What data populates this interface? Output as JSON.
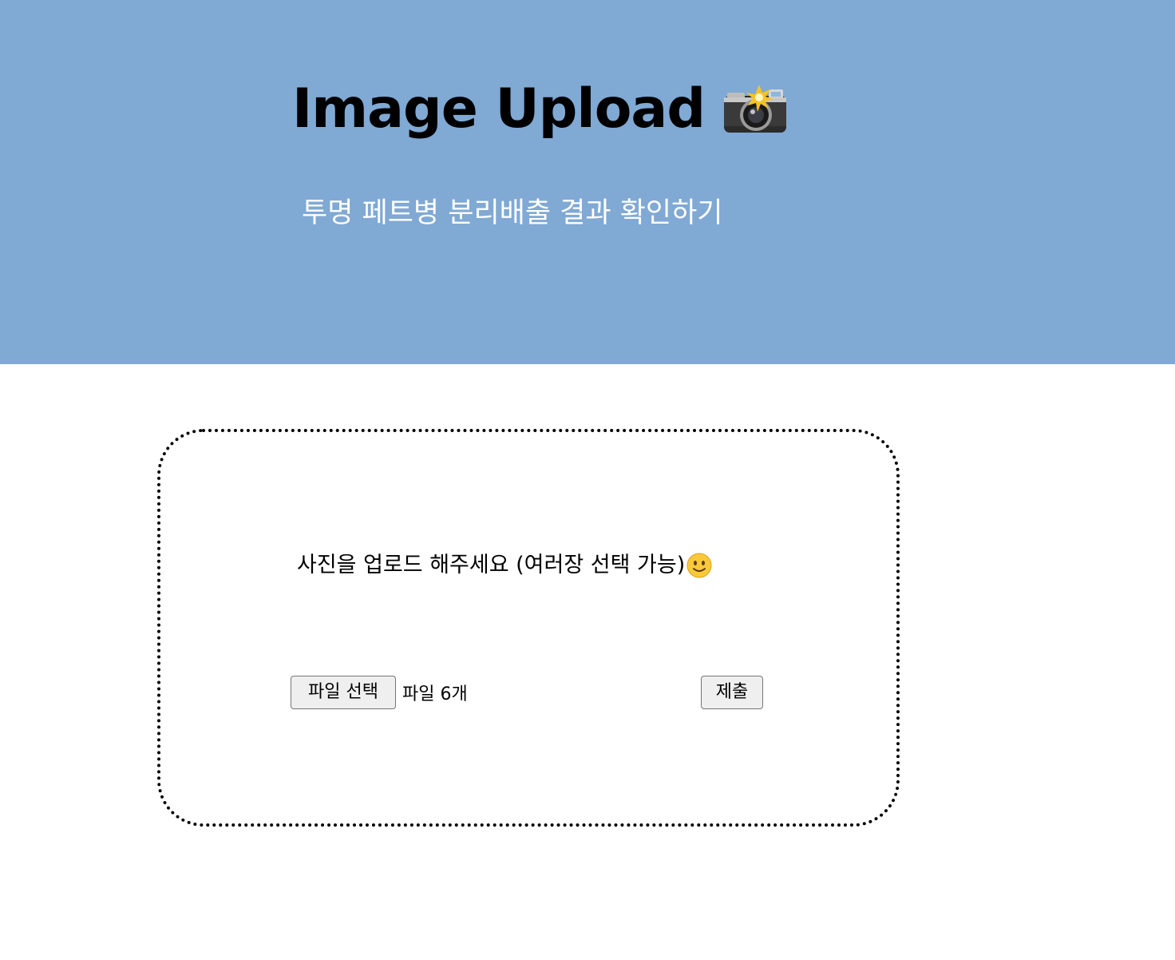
{
  "header": {
    "title": "Image Upload",
    "title_icon": "camera-with-flash-icon",
    "subtitle": "투명 페트병 분리배출 결과 확인하기",
    "background_color": "#80a9d4"
  },
  "upload": {
    "prompt": "사진을 업로드 해주세요 (여러장 선택 가능)",
    "prompt_icon": "slightly-smiling-face-icon",
    "file_button_label": "파일 선택",
    "file_status": "파일 6개",
    "submit_label": "제출"
  }
}
